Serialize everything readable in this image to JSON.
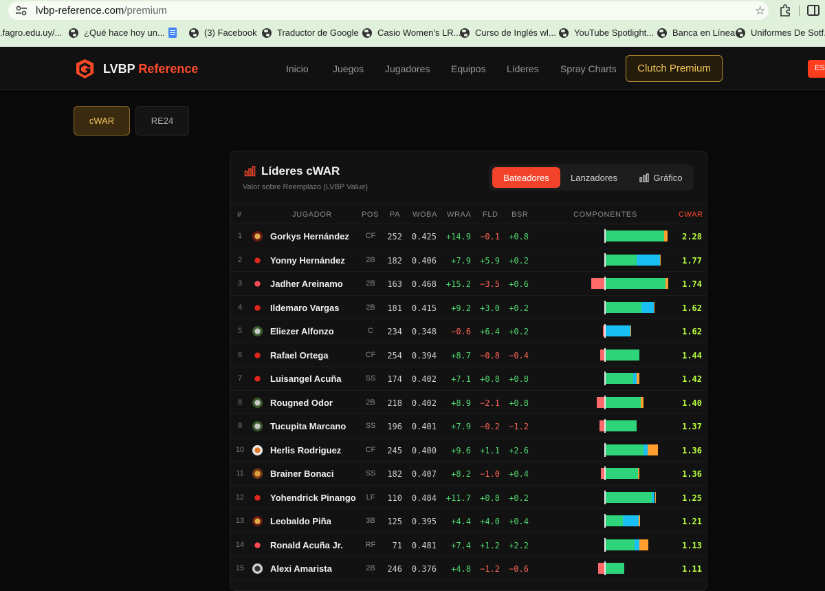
{
  "browser": {
    "url_host": "lvbp-reference.com",
    "url_path": "/premium",
    "bookmarks": [
      {
        "label": ".fagro.edu.uy/...",
        "icon": "none"
      },
      {
        "label": "¿Qué hace hoy un...",
        "icon": "globe-icon"
      },
      {
        "label": "",
        "icon": "google-docs-icon"
      },
      {
        "label": "(3) Facebook",
        "icon": "globe-icon"
      },
      {
        "label": "Traductor de Google",
        "icon": "globe-icon"
      },
      {
        "label": "Casio Women's LR...",
        "icon": "globe-icon"
      },
      {
        "label": "Curso de Inglés wl...",
        "icon": "globe-icon"
      },
      {
        "label": "YouTube Spotlight...",
        "icon": "globe-icon"
      },
      {
        "label": "Banca en Línea",
        "icon": "globe-icon"
      },
      {
        "label": "Uniformes De Sotf...",
        "icon": "globe-icon"
      }
    ]
  },
  "header": {
    "logo_text": "LVBP ",
    "logo_accent": "Reference",
    "nav": [
      "Inicio",
      "Juegos",
      "Jugadores",
      "Equipos",
      "Líderes",
      "Spray Charts"
    ],
    "premium_label": "Clutch Premium",
    "lang_label": "ES",
    "accent": "#ff4a2a"
  },
  "mode_tabs": [
    "cWAR",
    "RE24"
  ],
  "card": {
    "title": "Líderes cWAR",
    "subtitle": "Valor sobre Reemplazo (LVBP Value)",
    "segments": [
      "Bateadores",
      "Lanzadores",
      "Gráfico"
    ],
    "columns": [
      "#",
      "JUGADOR",
      "POS",
      "PA",
      "WOBA",
      "WRAA",
      "FLD",
      "BSR",
      "COMPONENTES",
      "CWAR"
    ]
  },
  "colors": {
    "positive": "#4fd96e",
    "negative": "#ff6358",
    "cwar": "#b9ff3c",
    "batting": "#2ed47a",
    "penalty": "#ff6a6a",
    "fielding": "#19bff2",
    "baserunning": "#ff9d2e"
  },
  "players": [
    {
      "rank": "1",
      "name": "Gorkys Hernández",
      "team": "leones",
      "pos": "CF",
      "pa": "252",
      "woba": "0.425",
      "wraa": "+14.9",
      "fld": "−0.1",
      "bsr": "+0.8",
      "cwar": "2.28"
    },
    {
      "rank": "2",
      "name": "Yonny Hernández",
      "team": "cardenales",
      "pos": "2B",
      "pa": "182",
      "woba": "0.406",
      "wraa": "+7.9",
      "fld": "+5.9",
      "bsr": "+0.2",
      "cwar": "1.77"
    },
    {
      "rank": "3",
      "name": "Jadher Areinamo",
      "team": "tiburones",
      "pos": "2B",
      "pa": "163",
      "woba": "0.468",
      "wraa": "+15.2",
      "fld": "−3.5",
      "bsr": "+0.6",
      "cwar": "1.74"
    },
    {
      "rank": "4",
      "name": "Ildemaro Vargas",
      "team": "cardenales",
      "pos": "2B",
      "pa": "181",
      "woba": "0.415",
      "wraa": "+9.2",
      "fld": "+3.0",
      "bsr": "+0.2",
      "cwar": "1.62"
    },
    {
      "rank": "5",
      "name": "Eliezer Alfonzo",
      "team": "magallanes",
      "pos": "C",
      "pa": "234",
      "woba": "0.348",
      "wraa": "−0.6",
      "fld": "+6.4",
      "bsr": "+0.2",
      "cwar": "1.62"
    },
    {
      "rank": "6",
      "name": "Rafael Ortega",
      "team": "cardenales",
      "pos": "CF",
      "pa": "254",
      "woba": "0.394",
      "wraa": "+8.7",
      "fld": "−0.8",
      "bsr": "−0.4",
      "cwar": "1.44"
    },
    {
      "rank": "7",
      "name": "Luisangel Acuña",
      "team": "cardenales",
      "pos": "SS",
      "pa": "174",
      "woba": "0.402",
      "wraa": "+7.1",
      "fld": "+0.8",
      "bsr": "+0.8",
      "cwar": "1.42"
    },
    {
      "rank": "8",
      "name": "Rougned Odor",
      "team": "magallanes",
      "pos": "2B",
      "pa": "218",
      "woba": "0.402",
      "wraa": "+8.9",
      "fld": "−2.1",
      "bsr": "+0.8",
      "cwar": "1.40"
    },
    {
      "rank": "9",
      "name": "Tucupita Marcano",
      "team": "magallanes",
      "pos": "SS",
      "pa": "196",
      "woba": "0.401",
      "wraa": "+7.9",
      "fld": "−0.2",
      "bsr": "−1.2",
      "cwar": "1.37"
    },
    {
      "rank": "10",
      "name": "Herlis Rodriguez",
      "team": "aguilas",
      "pos": "CF",
      "pa": "245",
      "woba": "0.400",
      "wraa": "+9.6",
      "fld": "+1.1",
      "bsr": "+2.6",
      "cwar": "1.36"
    },
    {
      "rank": "11",
      "name": "Brainer Bonaci",
      "team": "caribes",
      "pos": "SS",
      "pa": "182",
      "woba": "0.407",
      "wraa": "+8.2",
      "fld": "−1.0",
      "bsr": "+0.4",
      "cwar": "1.36"
    },
    {
      "rank": "12",
      "name": "Yohendrick Pinango",
      "team": "cardenales",
      "pos": "LF",
      "pa": "110",
      "woba": "0.484",
      "wraa": "+11.7",
      "fld": "+0.8",
      "bsr": "+0.2",
      "cwar": "1.25"
    },
    {
      "rank": "13",
      "name": "Leobaldo Piña",
      "team": "leones",
      "pos": "3B",
      "pa": "125",
      "woba": "0.395",
      "wraa": "+4.4",
      "fld": "+4.0",
      "bsr": "+0.4",
      "cwar": "1.21"
    },
    {
      "rank": "14",
      "name": "Ronald Acuña Jr.",
      "team": "tiburones",
      "pos": "RF",
      "pa": "71",
      "woba": "0.481",
      "wraa": "+7.4",
      "fld": "+1.2",
      "bsr": "+2.2",
      "cwar": "1.13"
    },
    {
      "rank": "15",
      "name": "Alexi Amarista",
      "team": "tigres",
      "pos": "2B",
      "pa": "246",
      "woba": "0.376",
      "wraa": "+4.8",
      "fld": "−1.2",
      "bsr": "−0.6",
      "cwar": "1.11"
    }
  ]
}
